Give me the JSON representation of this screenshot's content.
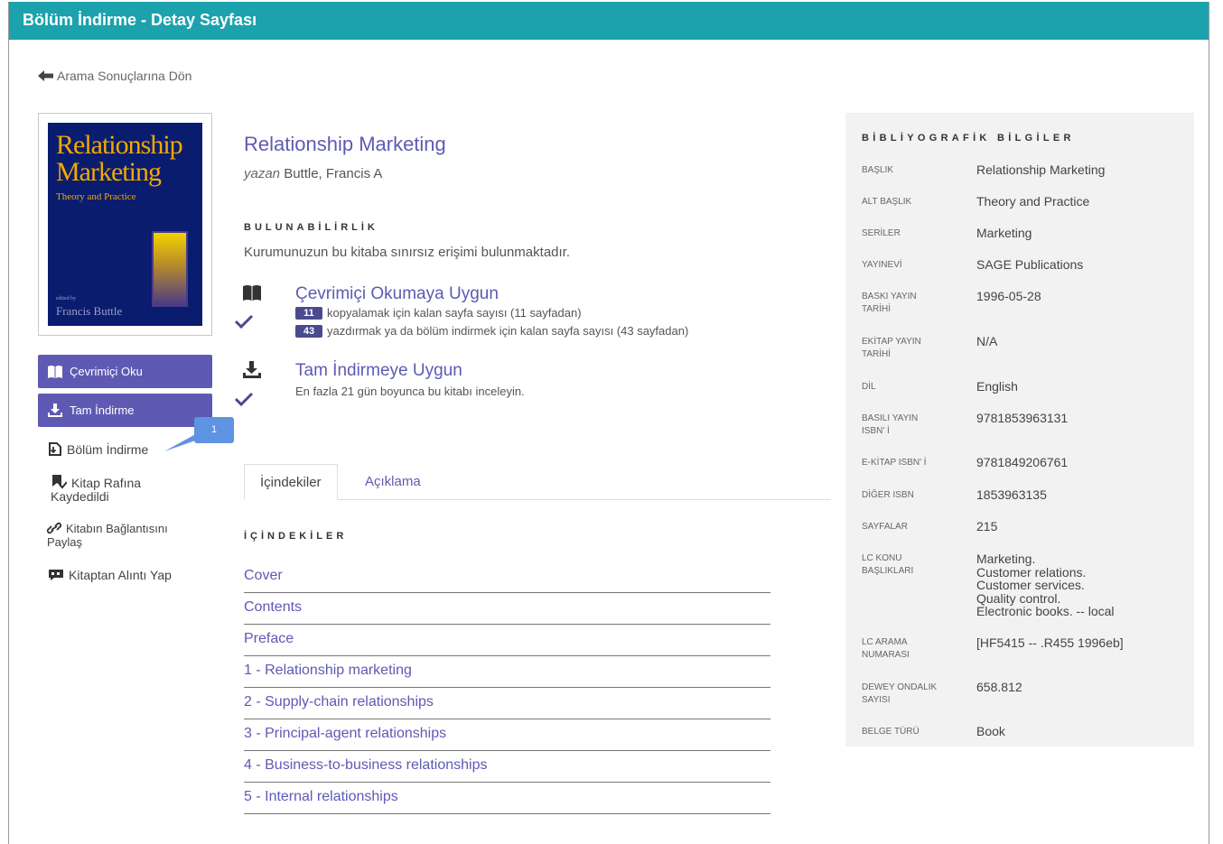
{
  "window": {
    "title": "Bölüm İndirme - Detay Sayfası"
  },
  "back_link": {
    "label": "Arama Sonuçlarına Dön"
  },
  "cover": {
    "title_line1": "Relationship",
    "title_line2": "Marketing",
    "subtitle": "Theory and Practice",
    "edited_by": "edited by",
    "author": "Francis Buttle"
  },
  "actions": {
    "read_online": "Çevrimiçi Oku",
    "full_download": "Tam İndirme",
    "chapter_download": "Bölüm İndirme",
    "saved_to_shelf": "Kitap Rafına Kaydedildi",
    "share_link": "Kitabın Bağlantısını Paylaş",
    "cite": "Kitaptan Alıntı Yap"
  },
  "callout": {
    "number": "1"
  },
  "book": {
    "title": "Relationship Marketing",
    "by_prefix": "yazan",
    "author": "Buttle, Francis A"
  },
  "availability": {
    "heading": "BULUNABİLİRLİK",
    "text": "Kurumunuzun bu kitaba sınırsız erişimi bulunmaktadır.",
    "online": {
      "title": "Çevrimiçi Okumaya Uygun",
      "copy_count": "11",
      "copy_text": "kopyalamak için kalan sayfa sayısı (11 sayfadan)",
      "print_count": "43",
      "print_text": "yazdırmak ya da bölüm indirmek için kalan sayfa sayısı (43 sayfadan)"
    },
    "download": {
      "title": "Tam İndirmeye Uygun",
      "text": "En fazla 21 gün boyunca bu kitabı inceleyin."
    }
  },
  "tabs": [
    {
      "label": "İçindekiler",
      "active": true
    },
    {
      "label": "Açıklama",
      "active": false
    }
  ],
  "toc": {
    "heading": "İÇİNDEKİLER",
    "items": [
      "Cover",
      "Contents",
      "Preface",
      "1 - Relationship marketing",
      "2 - Supply-chain relationships",
      "3 - Principal-agent relationships",
      "4 - Business-to-business relationships",
      "5 - Internal relationships"
    ]
  },
  "biblio": {
    "heading": "BİBLİYOGRAFİK BİLGİLER",
    "rows": [
      {
        "label": "BAŞLIK",
        "value": "Relationship Marketing"
      },
      {
        "label": "ALT BAŞLIK",
        "value": "Theory and Practice"
      },
      {
        "label": "SERİLER",
        "value": "Marketing"
      },
      {
        "label": "YAYINEVİ",
        "value": "SAGE Publications"
      },
      {
        "label": "BASKI YAYIN TARİHİ",
        "value": "1996-05-28"
      },
      {
        "label": "EKİTAP YAYIN TARİHİ",
        "value": "N/A"
      },
      {
        "label": "DİL",
        "value": "English"
      },
      {
        "label": "BASILI YAYIN ISBN' İ",
        "value": "9781853963131"
      },
      {
        "label": "E-KİTAP ISBN' İ",
        "value": "9781849206761"
      },
      {
        "label": "DİĞER ISBN",
        "value": "1853963135"
      },
      {
        "label": "SAYFALAR",
        "value": "215"
      },
      {
        "label": "LC KONU BAŞLIKLARI",
        "value": "Marketing.\nCustomer relations.\nCustomer services.\nQuality control.\nElectronic books. -- local"
      },
      {
        "label": "LC ARAMA NUMARASI",
        "value": "[HF5415 -- .R455 1996eb]"
      },
      {
        "label": "DEWEY ONDALIK SAYISI",
        "value": "658.812"
      },
      {
        "label": "BELGE TÜRÜ",
        "value": "Book"
      }
    ]
  },
  "colors": {
    "titlebar": "#1ba2ac",
    "accent": "#5e5ab3",
    "callout": "#5f93e4",
    "panel": "#f2f2f2"
  }
}
